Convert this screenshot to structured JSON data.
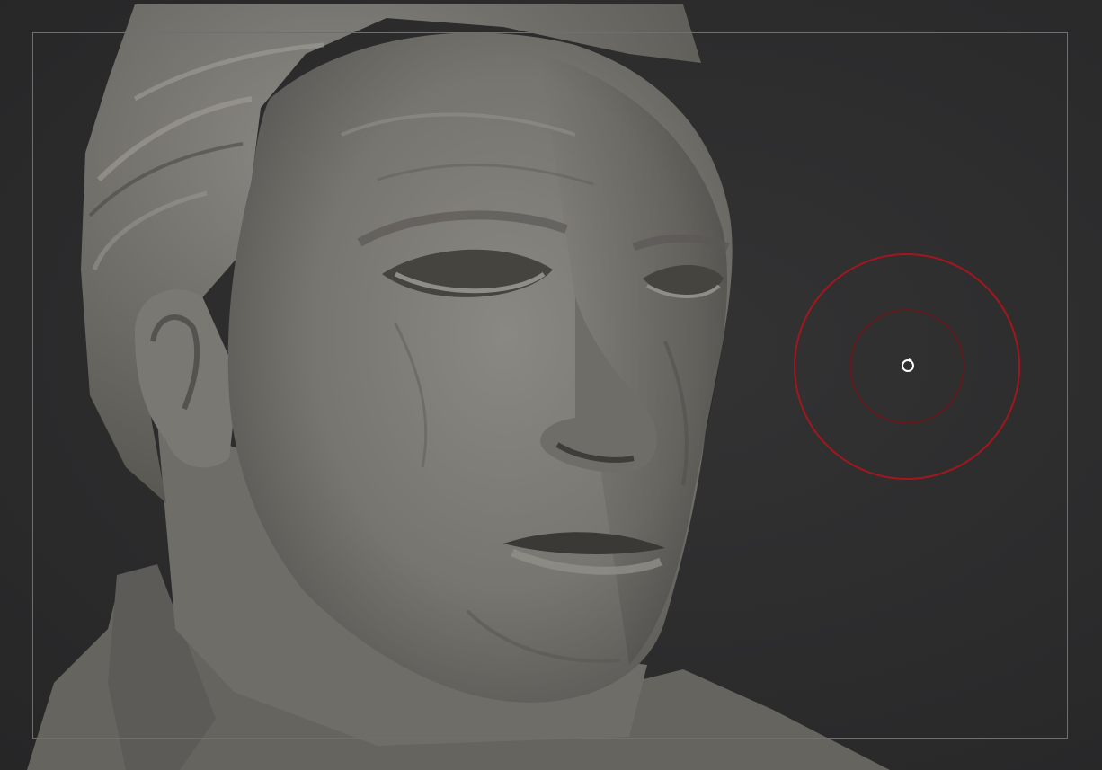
{
  "viewport": {
    "background_color": "#2c2c2d",
    "frame_color": "#6f6f6f"
  },
  "model": {
    "material_color": "#7d7b75"
  },
  "brush": {
    "outer_ring_color": "#a3161e",
    "inner_ring_color": "#6e1518",
    "cursor_icon": "rotate-cursor-icon"
  }
}
